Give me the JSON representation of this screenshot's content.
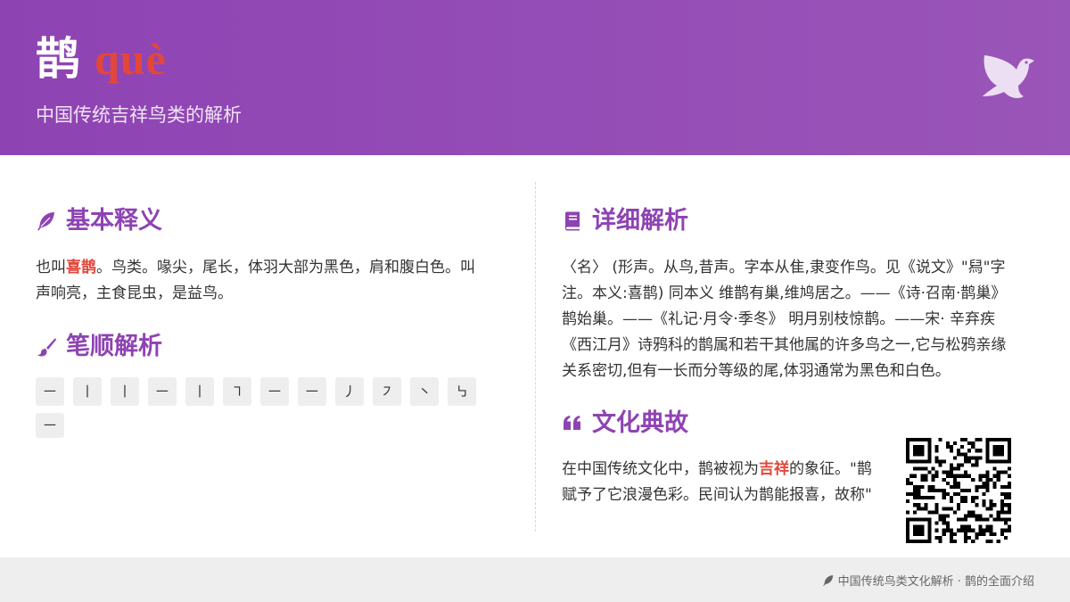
{
  "header": {
    "character": "鹊",
    "pinyin": "què",
    "subtitle": "中国传统吉祥鸟类的解析",
    "icon": "dove-icon"
  },
  "basic": {
    "title": "基本释义",
    "icon": "feather-icon",
    "text_before": "也叫",
    "highlight": "喜鹊",
    "text_line1_after": "。鸟类。喙尖，尾长，体羽大部为黑色，肩和腹白色。叫",
    "text_line2": "声响亮，主食昆虫，是益鸟。"
  },
  "strokes": {
    "title": "笔顺解析",
    "icon": "brush-icon",
    "items": [
      "㇐",
      "丨",
      "丨",
      "㇐",
      "丨",
      "㇕",
      "㇐",
      "㇐",
      "丿",
      "㇇",
      "㇔",
      "㇉",
      "㇐"
    ]
  },
  "detail": {
    "title": "详细解析",
    "icon": "book-icon",
    "lines": [
      "〈名〉 (形声。从鸟,昔声。字本从隹,隶变作鸟。见《说文》\"舄\"字",
      "注。本义:喜鹊) 同本义 维鹊有巢,维鸠居之。——《诗·召南·鹊巢》",
      "鹊始巢。——《礼记·月令·季冬》 明月别枝惊鹊。——宋· 辛弃疾",
      "《西江月》诗鸦科的鹊属和若干其他属的许多鸟之一,它与松鸦亲缘",
      "关系密切,但有一长而分等级的尾,体羽通常为黑色和白色。"
    ]
  },
  "culture": {
    "title": "文化典故",
    "icon": "quote-icon",
    "line1_before": "在中国传统文化中，鹊被视为",
    "highlight": "吉祥",
    "line1_after": "的象征。\"鹊",
    "line2": "赋予了它浪漫色彩。民间认为鹊能报喜，故称\""
  },
  "qr": {
    "icon": "qr-code-icon"
  },
  "footer": {
    "icon": "feather-icon",
    "text": "中国传统鸟类文化解析 · 鹊的全面介绍"
  },
  "colors": {
    "primary": "#8e43b3",
    "accent": "#e2473a",
    "footer_bg": "#eeeeee"
  }
}
